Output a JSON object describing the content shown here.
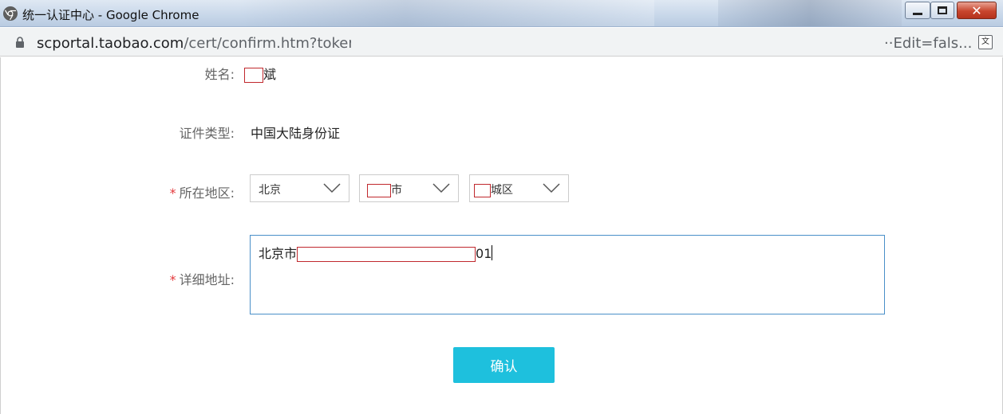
{
  "window": {
    "title": "统一认证中心 - Google Chrome",
    "app_icon": "chrome-icon",
    "close_glyph": "✕"
  },
  "address_bar": {
    "host": "scportal.taobao.com",
    "path": "/cert/confirm.htm?token=",
    "tail": "··Edit=fals...",
    "translate_glyph": "文"
  },
  "form": {
    "name": {
      "label": "姓名:",
      "value_suffix": "斌"
    },
    "id_type": {
      "label": "证件类型:",
      "value": "中国大陆身份证"
    },
    "region": {
      "required_mark": "*",
      "label": "所在地区:",
      "province": "北京",
      "city_suffix": "市",
      "district_suffix": "城区"
    },
    "address": {
      "required_mark": "*",
      "label": "详细地址:",
      "value_prefix": "北京市",
      "value_suffix": "01"
    },
    "confirm_label": "确认"
  },
  "colors": {
    "accent_button": "#1ec0dd",
    "required_mark": "#e4393c",
    "redaction_border": "#c0282d",
    "focused_border": "#4a8fc8"
  }
}
